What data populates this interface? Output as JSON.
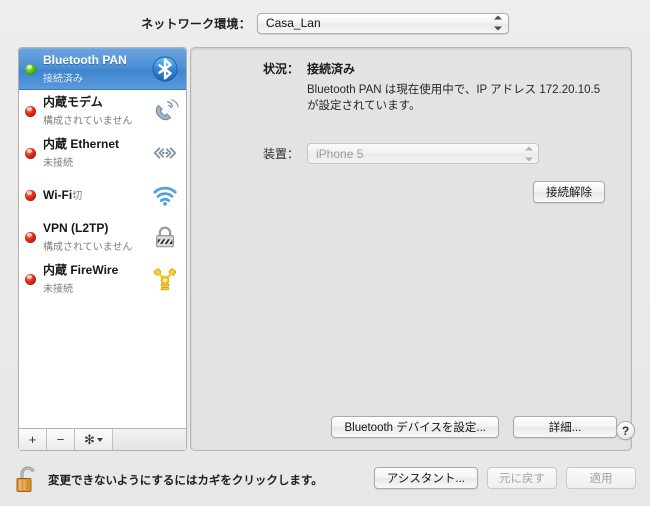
{
  "header": {
    "location_label": "ネットワーク環境：",
    "location_value": "Casa_Lan"
  },
  "sidebar": {
    "services": [
      {
        "name": "Bluetooth PAN",
        "status": "接続済み",
        "dot": "green",
        "icon": "bluetooth-icon",
        "selected": true
      },
      {
        "name": "内蔵モデム",
        "status": "構成されていません",
        "dot": "red",
        "icon": "modem-icon",
        "selected": false
      },
      {
        "name": "内蔵 Ethernet",
        "status": "未接続",
        "dot": "red",
        "icon": "ethernet-icon",
        "selected": false
      },
      {
        "name": "Wi-Fi",
        "status": "切",
        "dot": "red",
        "icon": "wifi-icon",
        "selected": false
      },
      {
        "name": "VPN (L2TP)",
        "status": "構成されていません",
        "dot": "red",
        "icon": "vpn-lock-icon",
        "selected": false
      },
      {
        "name": "内蔵 FireWire",
        "status": "未接続",
        "dot": "red",
        "icon": "firewire-icon",
        "selected": false
      }
    ],
    "toolbar": {
      "add_label": "+",
      "remove_label": "−",
      "gear_label": "✻"
    }
  },
  "detail": {
    "status_label": "状況：",
    "status_value": "接続済み",
    "status_description": "Bluetooth PAN は現在使用中で、IP アドレス 172.20.10.5 が設定されています。",
    "device_label": "装置：",
    "device_value": "iPhone 5",
    "disconnect_label": "接続解除",
    "configure_bluetooth_label": "Bluetooth デバイスを設定...",
    "advanced_label": "詳細...",
    "help_label": "?"
  },
  "footer": {
    "lock_note": "変更できないようにするにはカギをクリックします。",
    "assistant_label": "アシスタント...",
    "revert_label": "元に戻す",
    "apply_label": "適用"
  },
  "colors": {
    "selection_blue": "#4a8fd4",
    "status_green": "#56c416",
    "status_red": "#e02914",
    "window_bg": "#ececec",
    "panel_bg": "#e3e3e3"
  }
}
